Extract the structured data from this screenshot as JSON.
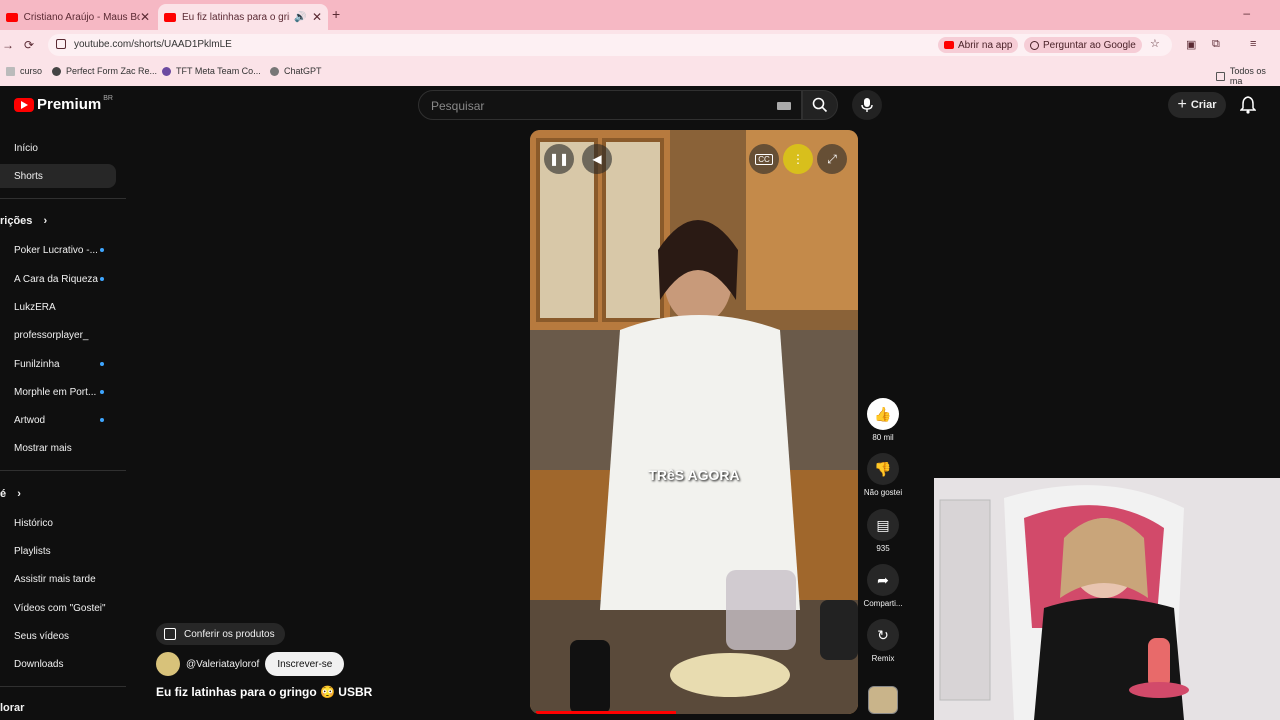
{
  "browser": {
    "tabs": [
      {
        "title": "Cristiano Araújo - Maus Bocado",
        "active": false
      },
      {
        "title": "Eu fiz latinhas para o gringo",
        "active": true
      }
    ],
    "url": "youtube.com/shorts/UAAD1PklmLE",
    "open_in_app_label": "Abrir na app",
    "ask_google_label": "Perguntar ao Google",
    "bookmarks": [
      "curso",
      "Perfect Form Zac Re...",
      "TFT Meta Team Co...",
      "ChatGPT"
    ],
    "all_bookmarks_label": "Todos os ma"
  },
  "youtube": {
    "logo_text": "Premium",
    "logo_region": "BR",
    "search_placeholder": "Pesquisar",
    "create_label": "Criar",
    "sidebar": {
      "top": [
        {
          "label": "Início",
          "active": false
        },
        {
          "label": "Shorts",
          "active": true
        }
      ],
      "subscriptions_header": "rições",
      "subscriptions": [
        {
          "label": "Poker Lucrativo -...",
          "dot": true
        },
        {
          "label": "A Cara da Riqueza",
          "dot": true
        },
        {
          "label": "LukzERA",
          "dot": false
        },
        {
          "label": "professorplayer_",
          "dot": false
        },
        {
          "label": "Funilzinha",
          "dot": true
        },
        {
          "label": "Morphle em Port...",
          "dot": true
        },
        {
          "label": "Artwod",
          "dot": true
        },
        {
          "label": "Mostrar mais",
          "dot": false
        }
      ],
      "you_header": "é",
      "you_items": [
        "Histórico",
        "Playlists",
        "Assistir mais tarde",
        "Vídeos com \"Gostei\"",
        "Seus vídeos",
        "Downloads"
      ],
      "explore_header": "lorar"
    },
    "short": {
      "caption": "TRêS AGORA",
      "products_label": "Conferir os produtos",
      "channel": "@Valeriataylorof",
      "subscribe_label": "Inscrever-se",
      "title": "Eu fiz latinhas para o gringo 😳 USBR",
      "actions": {
        "likes": "80 mil",
        "dislike": "Não gostei",
        "comments": "935",
        "share": "Comparti...",
        "remix": "Remix"
      }
    }
  },
  "colors": {
    "chrome_tab_bg": "#f6b8c4",
    "chrome_bar_bg": "#fbe3e8",
    "yt_bg": "#0f0f0f",
    "yt_red": "#ff0000",
    "unread_dot": "#3ea6ff"
  }
}
